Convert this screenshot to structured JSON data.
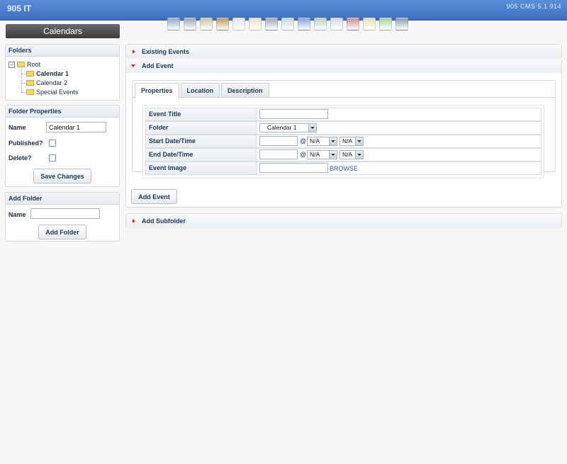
{
  "app": {
    "brand": "905 IT",
    "version": "905 CMS 5.1.914",
    "title": "Calendars"
  },
  "toolbar": {
    "icons": [
      {
        "name": "stats-icon",
        "color": "#8fa8c8"
      },
      {
        "name": "users-icon",
        "color": "#9aa7b8"
      },
      {
        "name": "edit-pencil-icon",
        "color": "#c9c2a8"
      },
      {
        "name": "add-image-icon",
        "color": "#b89a5a"
      },
      {
        "name": "font-icon",
        "color": "#dfe4ea"
      },
      {
        "name": "mail-icon",
        "color": "#e8e2c8"
      },
      {
        "name": "database-icon",
        "color": "#9ca6b4"
      },
      {
        "name": "list-icon",
        "color": "#c7d3e3"
      },
      {
        "name": "contact-icon",
        "color": "#7fa3d9"
      },
      {
        "name": "check-doc-icon",
        "color": "#bcd0c0"
      },
      {
        "name": "form-icon",
        "color": "#d4dbe4"
      },
      {
        "name": "tools-icon",
        "color": "#c88b8b"
      },
      {
        "name": "calendar-icon",
        "color": "#e5dcb8"
      },
      {
        "name": "phone-icon",
        "color": "#9fd29f"
      },
      {
        "name": "logout-icon",
        "color": "#8d9bb0"
      }
    ]
  },
  "sidebar": {
    "folders": {
      "heading": "Folders",
      "root": "Root",
      "items": [
        "Calendar 1",
        "Calendar 2",
        "Special Events"
      ]
    },
    "folder_properties": {
      "heading": "Folder Properties",
      "name_label": "Name",
      "name_value": "Calendar 1",
      "published_label": "Published?",
      "delete_label": "Delete?",
      "save_label": "Save Changes"
    },
    "add_folder": {
      "heading": "Add Folder",
      "name_label": "Name",
      "name_value": "",
      "button_label": "Add Folder"
    }
  },
  "main": {
    "existing_events": "Existing Events",
    "add_event": "Add Event",
    "add_subfolder": "Add Subfolder",
    "tabs": [
      "Properties",
      "Location",
      "Description"
    ],
    "form": {
      "event_title_label": "Event Title",
      "folder_label": "Folder",
      "folder_value": "Calendar 1",
      "start_label": "Start Date/Time",
      "end_label": "End Date/Time",
      "image_label": "Event Image",
      "at_symbol": "@",
      "hour_value": "N/A",
      "minute_value": "N/A",
      "browse_label": "BROWSE"
    },
    "add_event_button": "Add Event"
  }
}
